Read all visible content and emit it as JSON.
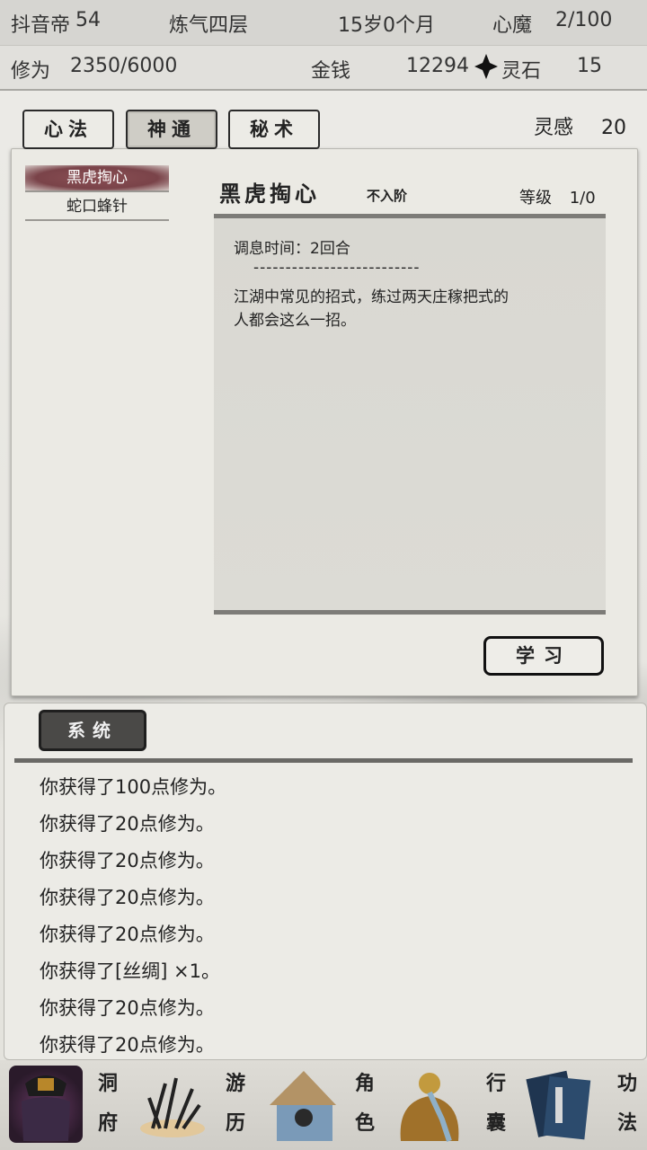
{
  "status": {
    "ghost_text": "54",
    "name": "抖音帝",
    "realm": "炼气四层",
    "age": "15岁0个月",
    "demon_label": "心魔",
    "demon_value": "2/100"
  },
  "stats": {
    "cultivation_label": "修为",
    "cultivation_value": "2350/6000",
    "money_label": "金钱",
    "money_value": "12294",
    "spirit_stone_label": "灵石",
    "spirit_stone_value": "15",
    "inspiration_label": "灵感",
    "inspiration_value": "20"
  },
  "tabs": [
    "心法",
    "神通",
    "秘术"
  ],
  "skills": [
    "黑虎掏心",
    "蛇口蜂针"
  ],
  "detail": {
    "title": "黑虎掏心",
    "rank": "不入阶",
    "level_label": "等级",
    "level_value": "1/0",
    "rest_time": "调息时间：2回合",
    "divider": "--------------------------",
    "desc_line1": "江湖中常见的招式，练过两天庄稼把式的",
    "desc_line2": "人都会这么一招。",
    "learn_button": "学习"
  },
  "log": {
    "tab_label": "系统",
    "messages": [
      "你获得了100点修为。",
      "你获得了20点修为。",
      "你获得了20点修为。",
      "你获得了20点修为。",
      "你获得了20点修为。",
      "你获得了[丝绸] ×1。",
      "你获得了20点修为。",
      "你获得了20点修为。"
    ]
  },
  "nav": {
    "cave": [
      "洞",
      "府"
    ],
    "travel": [
      "游",
      "历"
    ],
    "character": [
      "角",
      "色"
    ],
    "bag": [
      "行",
      "囊"
    ],
    "skills": [
      "功",
      "法"
    ]
  },
  "colors": {
    "selected_skill": "#7a4349",
    "system_button": "#4a4947",
    "panel": "#ebeae4"
  }
}
